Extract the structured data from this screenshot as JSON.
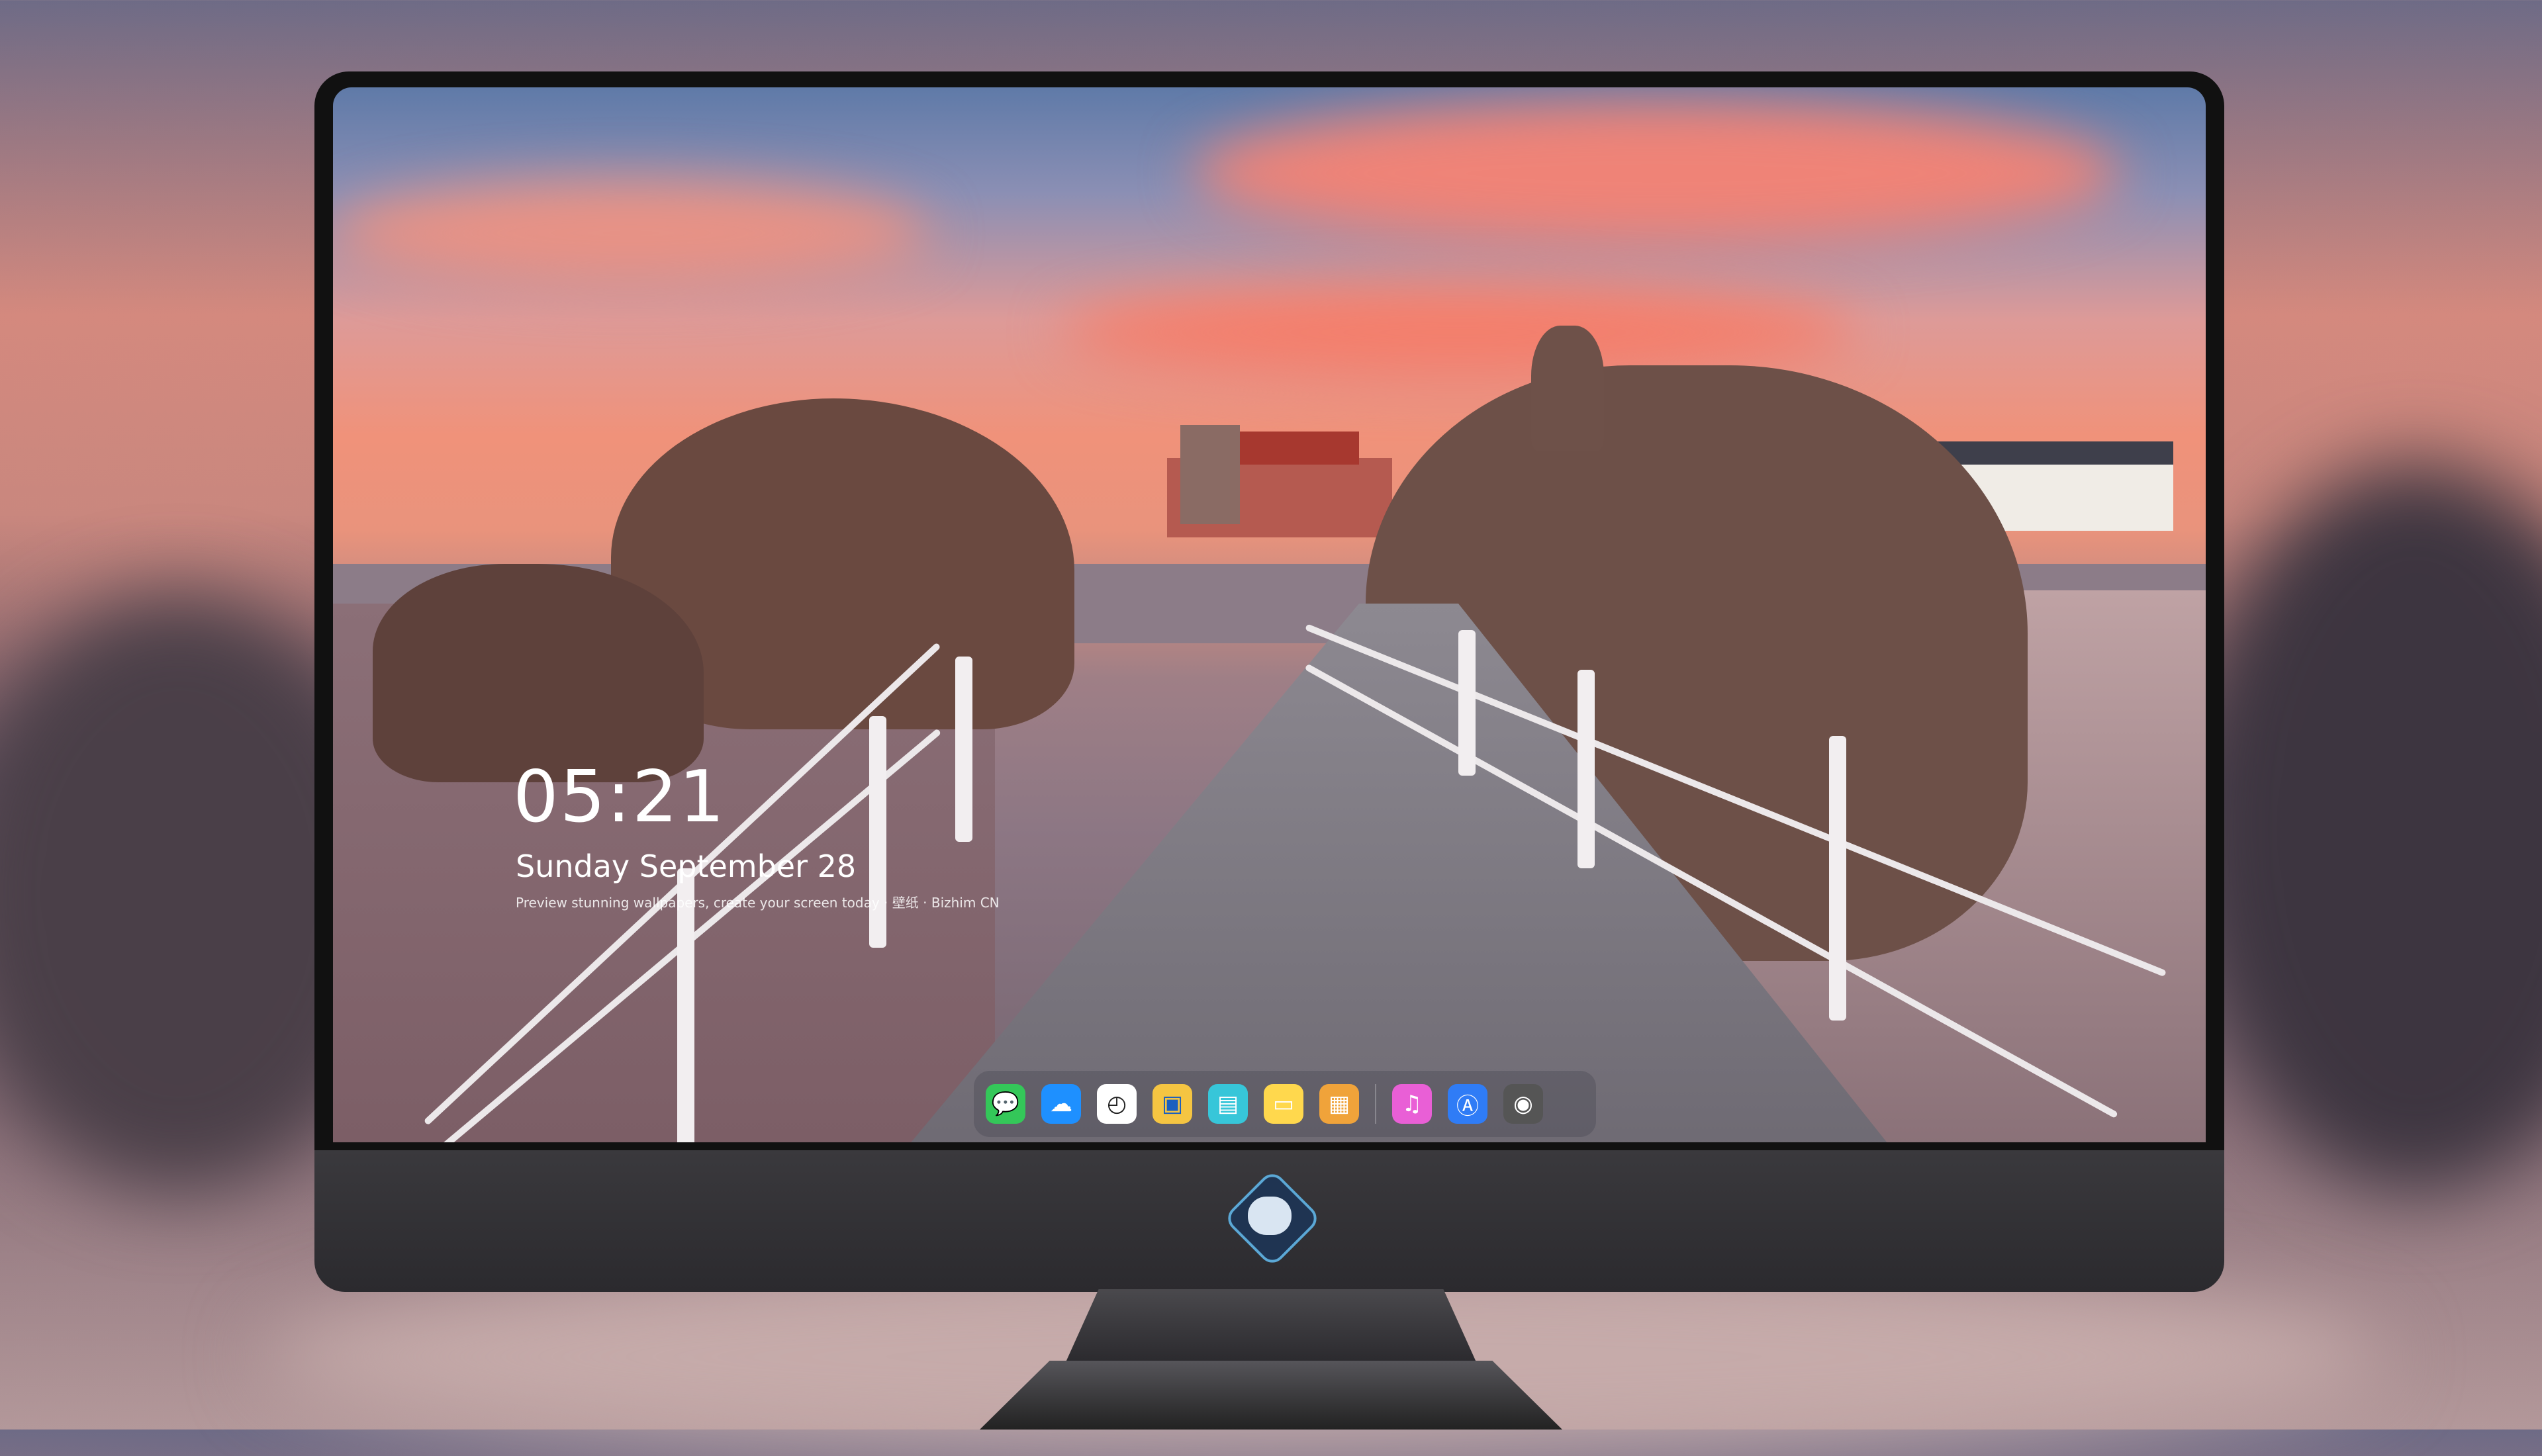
{
  "clock": {
    "time": "05:21",
    "date": "Sunday September  28",
    "caption": "Preview stunning wallpapers, create your screen today · 壁纸 · Bizhim CN"
  },
  "dock": {
    "apps": [
      {
        "name": "Messages",
        "icon": "messages-icon",
        "color": "#34c759"
      },
      {
        "name": "Weather",
        "icon": "weather-icon",
        "color": "#1e90ff"
      },
      {
        "name": "Clock",
        "icon": "clock-icon",
        "color": "#ffffff"
      },
      {
        "name": "Preview",
        "icon": "preview-icon",
        "color": "#f5c542"
      },
      {
        "name": "Clapper",
        "icon": "clapper-icon",
        "color": "#37c6d9"
      },
      {
        "name": "Notes",
        "icon": "notes-icon",
        "color": "#ffd84d"
      },
      {
        "name": "Photo Booth",
        "icon": "photo-icon",
        "color": "#f0a33a"
      },
      {
        "name": "Music",
        "icon": "music-icon",
        "color": "#e95fd6"
      },
      {
        "name": "App Store",
        "icon": "app-store-icon",
        "color": "#2f7cf6"
      },
      {
        "name": "Camera",
        "icon": "camera-icon",
        "color": "#555555"
      }
    ]
  },
  "monitor": {
    "logo": "mascot-logo-icon"
  }
}
